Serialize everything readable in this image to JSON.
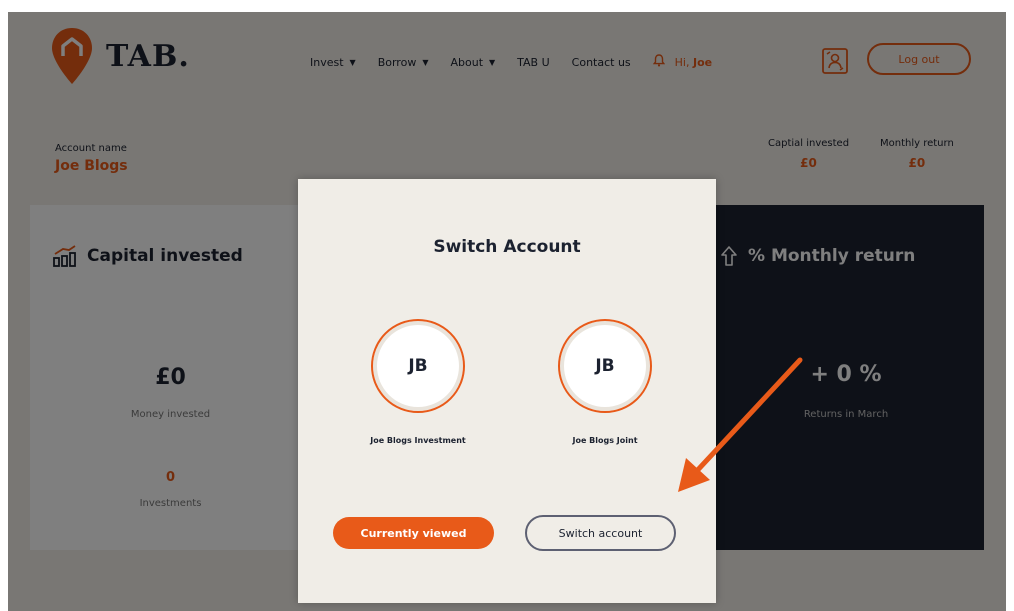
{
  "brand": {
    "name": "TAB.",
    "accent": "#e85a19",
    "dark": "#1c2230"
  },
  "nav": {
    "items": [
      {
        "label": "Invest",
        "dropdown": true
      },
      {
        "label": "Borrow",
        "dropdown": true
      },
      {
        "label": "About",
        "dropdown": true
      },
      {
        "label": "TAB U",
        "dropdown": false
      },
      {
        "label": "Contact us",
        "dropdown": false
      }
    ],
    "greeting_prefix": "Hi,",
    "greeting_name": "Joe",
    "logout_label": "Log out",
    "icons": [
      "bell-icon",
      "switch-account-icon",
      "caret-down-icon"
    ]
  },
  "account": {
    "label": "Account name",
    "name": "Joe Blogs",
    "capital_invested_label": "Captial invested",
    "capital_invested_value": "£0",
    "monthly_return_label": "Monthly return",
    "monthly_return_value": "£0"
  },
  "cards": {
    "capital": {
      "title": "Capital invested",
      "value": "£0",
      "value_label": "Money invested",
      "count": "0",
      "count_label": "Investments"
    },
    "returns": {
      "title": "% Monthly return",
      "value": "+ 0 %",
      "value_label": "Returns in March"
    }
  },
  "modal": {
    "title": "Switch Account",
    "accounts": [
      {
        "initials": "JB",
        "label": "Joe Blogs Investment"
      },
      {
        "initials": "JB",
        "label": "Joe Blogs Joint"
      }
    ],
    "current_label": "Currently viewed",
    "switch_label": "Switch account"
  },
  "annotation": {
    "arrow_color": "#e85a19"
  }
}
